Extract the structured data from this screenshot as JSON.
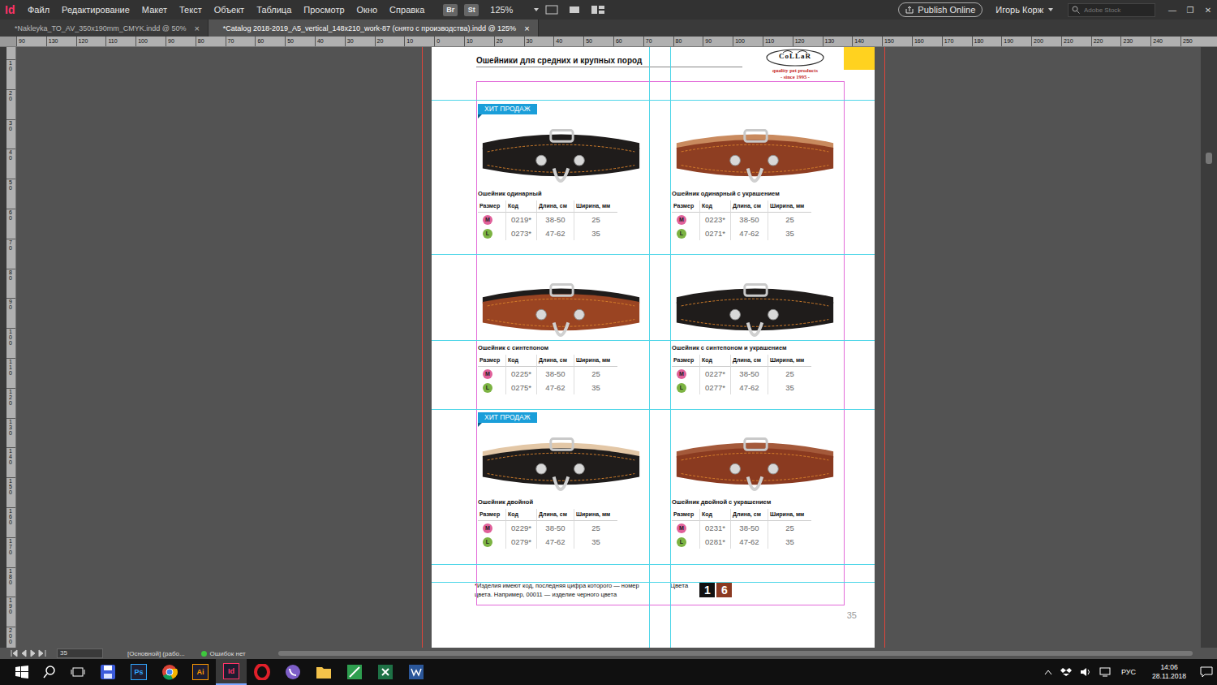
{
  "app": {
    "logo": "Id",
    "menu": [
      "Файл",
      "Редактирование",
      "Макет",
      "Текст",
      "Объект",
      "Таблица",
      "Просмотр",
      "Окно",
      "Справка"
    ],
    "bridge": "Br",
    "stock": "St",
    "zoom": "125%",
    "publish": "Publish Online",
    "user": "Игорь Корж",
    "search": {
      "placeholder": "Adobe Stock"
    },
    "window_controls": [
      "—",
      "❐",
      "✕"
    ]
  },
  "tabs": [
    {
      "label": "*Nakleyka_TO_AV_350x190mm_CMYK.indd @ 50%",
      "selected": false,
      "close": "×"
    },
    {
      "label": "*Catalog 2018-2019_A5_vertical_148x210_work-87 (снято с производства).indd @ 125%",
      "selected": true,
      "close": "×"
    }
  ],
  "rulers": {
    "horizontal": [
      "90",
      "130",
      "120",
      "110",
      "100",
      "90",
      "80",
      "70",
      "60",
      "50",
      "40",
      "30",
      "20",
      "10",
      "0",
      "10",
      "20",
      "30",
      "40",
      "50",
      "60",
      "70",
      "80",
      "90",
      "100",
      "110",
      "120",
      "130",
      "140",
      "150",
      "160",
      "170",
      "180",
      "190",
      "200",
      "210",
      "220",
      "230",
      "240",
      "250"
    ],
    "vertical": [
      "10",
      "20",
      "30",
      "40",
      "50",
      "60",
      "70",
      "80",
      "90",
      "100",
      "110",
      "120",
      "130",
      "140",
      "150",
      "160",
      "170",
      "180",
      "190",
      "200"
    ]
  },
  "page": {
    "title": "Ошейники для средних и крупных пород",
    "brand": {
      "name": "CoLLaR",
      "tagline": "quality pet products",
      "since": "- since 1995 -"
    },
    "table_headers": [
      "Размер",
      "Код",
      "Длина, см",
      "Ширина, мм"
    ],
    "products": [
      {
        "name": "Ошейник одинарный",
        "badge": "ХИТ ПРОДАЖ",
        "color": "#1f1c1b",
        "lining": "#1f1c1b",
        "rows": [
          {
            "size": "M",
            "color": "#e0609a",
            "code": "0219*",
            "length": "38-50",
            "width": "25"
          },
          {
            "size": "L",
            "color": "#7cb342",
            "code": "0273*",
            "length": "47-62",
            "width": "35"
          }
        ]
      },
      {
        "name": "Ошейник одинарный с украшением",
        "badge": "",
        "color": "#8e3e22",
        "lining": "#c98a5e",
        "rows": [
          {
            "size": "M",
            "color": "#e0609a",
            "code": "0223*",
            "length": "38-50",
            "width": "25"
          },
          {
            "size": "L",
            "color": "#7cb342",
            "code": "0271*",
            "length": "47-62",
            "width": "35"
          }
        ]
      },
      {
        "name": "Ошейник с синтепоном",
        "badge": "",
        "color": "#9a4422",
        "lining": "#1f1c1b",
        "rows": [
          {
            "size": "M",
            "color": "#e0609a",
            "code": "0225*",
            "length": "38-50",
            "width": "25"
          },
          {
            "size": "L",
            "color": "#7cb342",
            "code": "0275*",
            "length": "47-62",
            "width": "35"
          }
        ]
      },
      {
        "name": "Ошейник с синтепоном и украшением",
        "badge": "",
        "color": "#1f1c1b",
        "lining": "#1f1c1b",
        "rows": [
          {
            "size": "M",
            "color": "#e0609a",
            "code": "0227*",
            "length": "38-50",
            "width": "25"
          },
          {
            "size": "L",
            "color": "#7cb342",
            "code": "0277*",
            "length": "47-62",
            "width": "35"
          }
        ]
      },
      {
        "name": "Ошейник двойной",
        "badge": "ХИТ ПРОДАЖ",
        "color": "#1f1c1b",
        "lining": "#e3c7a6",
        "rows": [
          {
            "size": "M",
            "color": "#e0609a",
            "code": "0229*",
            "length": "38-50",
            "width": "25"
          },
          {
            "size": "L",
            "color": "#7cb342",
            "code": "0279*",
            "length": "47-62",
            "width": "35"
          }
        ]
      },
      {
        "name": "Ошейник двойной с  украшением",
        "badge": "",
        "color": "#8a3a20",
        "lining": "#a4593a",
        "rows": [
          {
            "size": "M",
            "color": "#e0609a",
            "code": "0231*",
            "length": "38-50",
            "width": "25"
          },
          {
            "size": "L",
            "color": "#7cb342",
            "code": "0281*",
            "length": "47-62",
            "width": "35"
          }
        ]
      }
    ],
    "note": "*Изделия имеют код, последняя цифра которого — номер цвета. Например, 00011 — изделие черного цвета",
    "colors_label": "Цвета",
    "swatches": [
      {
        "label": "1",
        "color": "#111111"
      },
      {
        "label": "6",
        "color": "#8b3a22"
      }
    ],
    "page_number": "35"
  },
  "status_bar": {
    "page": "35",
    "mode": "[Основной] (рабо...",
    "preflight": "Ошибок нет"
  },
  "taskbar": {
    "apps": [
      {
        "label": "Ps",
        "color": "#31a8ff",
        "selected": false
      },
      {
        "label": "Ai",
        "color": "#ff9a00",
        "selected": false
      },
      {
        "label": "Id",
        "color": "#ff3366",
        "selected": true
      }
    ],
    "lang": "РУС",
    "time": "14:06",
    "date": "28.11.2018"
  }
}
